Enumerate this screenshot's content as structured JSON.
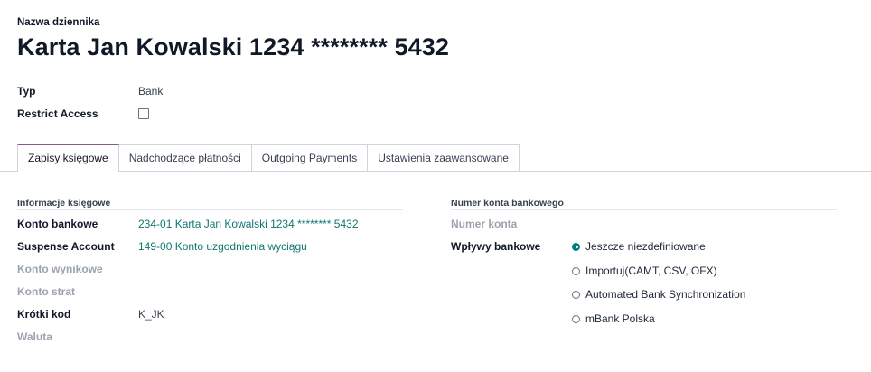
{
  "header": {
    "journal_label": "Nazwa dziennika",
    "journal_name": "Karta Jan Kowalski 1234 ******** 5432"
  },
  "top_fields": {
    "type_label": "Typ",
    "type_value": "Bank",
    "restrict_label": "Restrict Access",
    "restrict_checked": false
  },
  "tabs": [
    {
      "label": "Zapisy księgowe",
      "active": true
    },
    {
      "label": "Nadchodzące płatności",
      "active": false
    },
    {
      "label": "Outgoing Payments",
      "active": false
    },
    {
      "label": "Ustawienia zaawansowane",
      "active": false
    }
  ],
  "accounting": {
    "section_title": "Informacje księgowe",
    "bank_account_label": "Konto bankowe",
    "bank_account_value": "234-01 Karta Jan Kowalski 1234 ******** 5432",
    "suspense_label": "Suspense Account",
    "suspense_value": "149-00 Konto uzgodnienia wyciągu",
    "profit_label": "Konto wynikowe",
    "loss_label": "Konto strat",
    "short_code_label": "Krótki kod",
    "short_code_value": "K_JK",
    "currency_label": "Waluta"
  },
  "bank_number": {
    "section_title": "Numer konta bankowego",
    "account_number_label": "Numer konta",
    "feeds_label": "Wpływy bankowe",
    "feed_options": [
      {
        "label": "Jeszcze niezdefiniowane",
        "checked": true
      },
      {
        "label": "Importuj(CAMT, CSV, OFX)",
        "checked": false
      },
      {
        "label": "Automated Bank Synchronization",
        "checked": false
      },
      {
        "label": "mBank Polska",
        "checked": false
      }
    ]
  }
}
